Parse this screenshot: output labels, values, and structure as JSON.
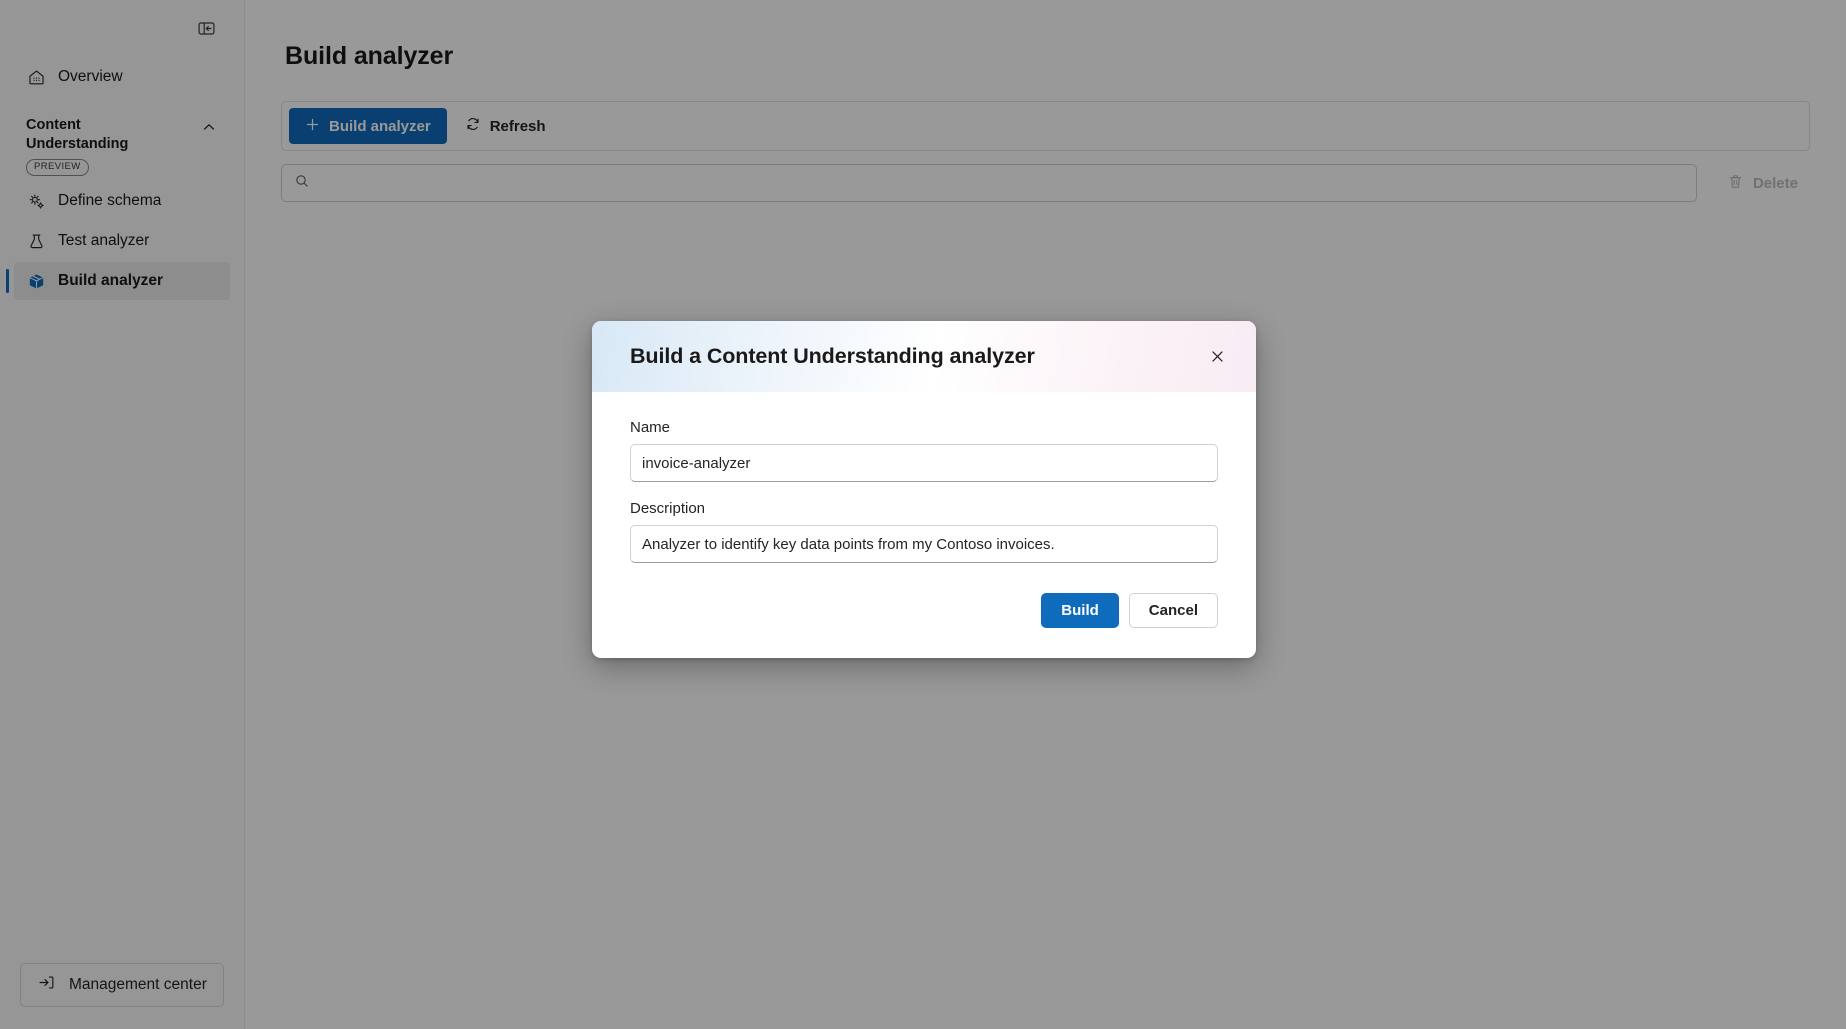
{
  "sidebar": {
    "collapse_icon": "panel-collapse-icon",
    "items": [
      {
        "label": "Overview",
        "icon": "home-icon",
        "active": false
      }
    ],
    "group": {
      "title": "Content Understanding",
      "badge": "PREVIEW",
      "chevron": "chevron-up-icon",
      "items": [
        {
          "label": "Define schema",
          "icon": "schema-gears-icon",
          "active": false
        },
        {
          "label": "Test analyzer",
          "icon": "beaker-icon",
          "active": false
        },
        {
          "label": "Build analyzer",
          "icon": "cube-box-icon",
          "active": true
        }
      ]
    },
    "footer": {
      "label": "Management center",
      "icon": "arrow-into-bracket-icon"
    }
  },
  "main": {
    "page_title": "Build analyzer",
    "command_bar": {
      "build_label": "Build analyzer",
      "build_icon": "plus-icon",
      "refresh_label": "Refresh",
      "refresh_icon": "refresh-icon"
    },
    "search": {
      "icon": "search-icon",
      "value": "",
      "placeholder": ""
    },
    "delete": {
      "label": "Delete",
      "icon": "trash-icon"
    }
  },
  "dialog": {
    "title": "Build a Content Understanding analyzer",
    "close_icon": "close-icon",
    "name_label": "Name",
    "name_value": "invoice-analyzer",
    "name_placeholder": "",
    "description_label": "Description",
    "description_value": "Analyzer to identify key data points from my Contoso invoices.",
    "description_placeholder": "",
    "build_label": "Build",
    "cancel_label": "Cancel"
  },
  "colors": {
    "accent": "#0f6cbd",
    "active_bg": "#ebebeb",
    "sidebar_bg": "#fbfbfb",
    "disabled_text": "#bdbdbd"
  }
}
